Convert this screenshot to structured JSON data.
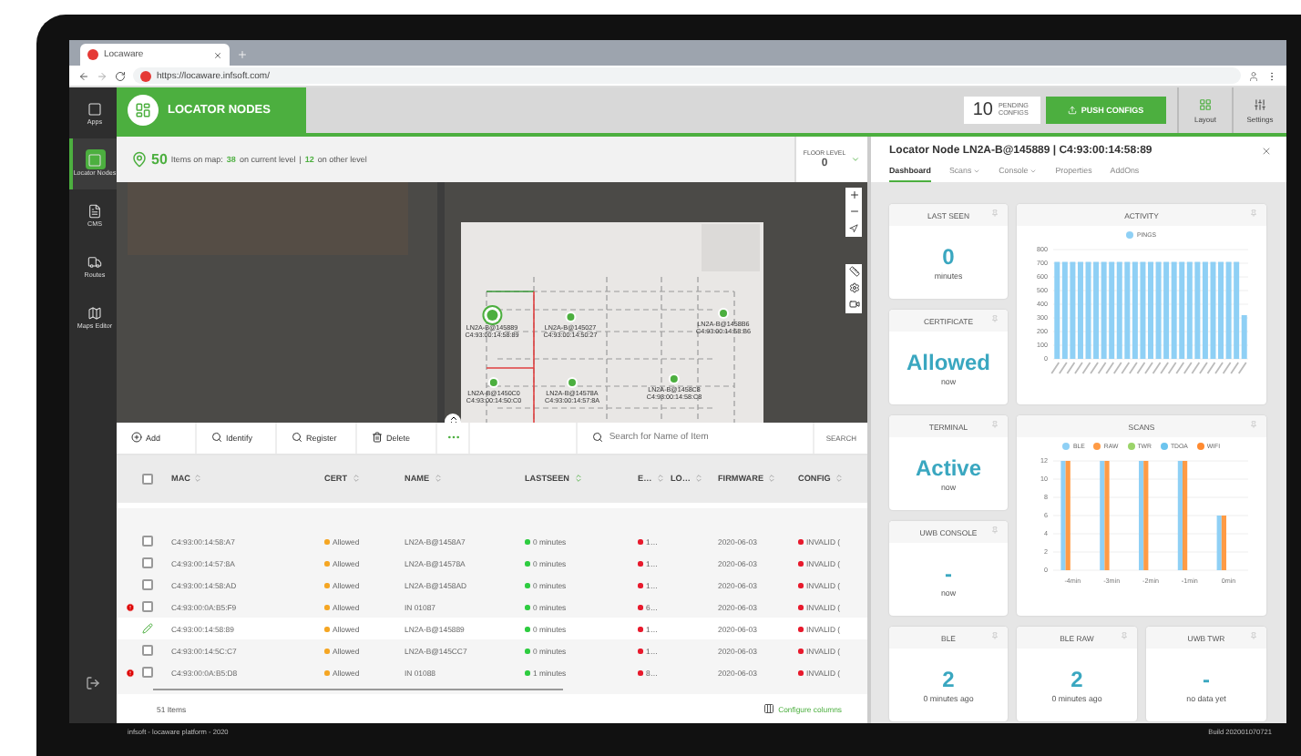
{
  "browser": {
    "tab_title": "Locaware",
    "url": "https://locaware.infsoft.com/"
  },
  "sidebar": {
    "items": [
      {
        "label": "Apps",
        "selected": false
      },
      {
        "label": "Locator Nodes",
        "selected": true
      },
      {
        "label": "CMS",
        "selected": false
      },
      {
        "label": "Routes",
        "selected": false
      },
      {
        "label": "Maps Editor",
        "selected": false
      }
    ]
  },
  "header": {
    "title": "LOCATOR NODES",
    "pending_count": "10",
    "pending_label": "PENDING CONFIGS",
    "push_button": "PUSH CONFIGS",
    "tools": [
      "Layout",
      "Settings"
    ]
  },
  "map_info": {
    "count": "50",
    "text": "Items on map:",
    "current_count": "38",
    "current_label": "on current level",
    "separator": "|",
    "other_count": "12",
    "other_label": "on other level",
    "floor_label": "FLOOR LEVEL",
    "floor_value": "0"
  },
  "map": {
    "nodes": [
      {
        "name": "LN2A-B@145889",
        "mac": "C4:93:00:14:58:89",
        "selected": true
      },
      {
        "name": "LN2A-B@145027",
        "mac": "C4:93:00:14:50:27",
        "selected": false
      },
      {
        "name": "LN2A-B@1458B6",
        "mac": "C4:93:00:14:58:B6",
        "selected": false
      },
      {
        "name": "LN2A-B@1450C0",
        "mac": "C4:93:00:14:50:C0",
        "selected": false
      },
      {
        "name": "LN2A-B@14578A",
        "mac": "C4:93:00:14:57:8A",
        "selected": false
      },
      {
        "name": "LN2A-B@1458C8",
        "mac": "C4:93:00:14:58:C8",
        "selected": false
      }
    ]
  },
  "toolbar": {
    "actions": [
      "Add",
      "Identify",
      "Register",
      "Delete"
    ],
    "search": {
      "placeholder": "Search for Name of Item"
    },
    "search_button": "SEARCH"
  },
  "table": {
    "select_all_checked": false,
    "columns": [
      {
        "label": "MAC",
        "sorted": false
      },
      {
        "label": "CERT",
        "sorted": false
      },
      {
        "label": "NAME",
        "sorted": false
      },
      {
        "label": "LASTSEEN",
        "sorted": true
      },
      {
        "label": "E…",
        "sorted": false
      },
      {
        "label": "LO…",
        "sorted": false
      },
      {
        "label": "FIRMWARE",
        "sorted": false
      },
      {
        "label": "CONFIG",
        "sorted": false
      }
    ],
    "rows": [
      {
        "alert": false,
        "selected": false,
        "mac": "C4:93:00:14:58:A7",
        "cert": "Allowed",
        "name": "LN2A-B@1458A7",
        "lastseen": "0 minutes",
        "e": "1…",
        "firmware": "2020-06-03",
        "config": "INVALID ("
      },
      {
        "alert": false,
        "selected": false,
        "mac": "C4:93:00:14:57:8A",
        "cert": "Allowed",
        "name": "LN2A-B@14578A",
        "lastseen": "0 minutes",
        "e": "1…",
        "firmware": "2020-06-03",
        "config": "INVALID ("
      },
      {
        "alert": false,
        "selected": false,
        "mac": "C4:93:00:14:58:AD",
        "cert": "Allowed",
        "name": "LN2A-B@1458AD",
        "lastseen": "0 minutes",
        "e": "1…",
        "firmware": "2020-06-03",
        "config": "INVALID ("
      },
      {
        "alert": true,
        "selected": false,
        "mac": "C4:93:00:0A:B5:F9",
        "cert": "Allowed",
        "name": "IN 01087",
        "lastseen": "0 minutes",
        "e": "6…",
        "firmware": "2020-06-03",
        "config": "INVALID ("
      },
      {
        "alert": false,
        "selected": true,
        "mac": "C4:93:00:14:58:89",
        "cert": "Allowed",
        "name": "LN2A-B@145889",
        "lastseen": "0 minutes",
        "e": "1…",
        "firmware": "2020-06-03",
        "config": "INVALID ("
      },
      {
        "alert": false,
        "selected": false,
        "mac": "C4:93:00:14:5C:C7",
        "cert": "Allowed",
        "name": "LN2A-B@145CC7",
        "lastseen": "0 minutes",
        "e": "1…",
        "firmware": "2020-06-03",
        "config": "INVALID ("
      },
      {
        "alert": true,
        "selected": false,
        "mac": "C4:93:00:0A:B5:D8",
        "cert": "Allowed",
        "name": "IN 01088",
        "lastseen": "1 minutes",
        "e": "8…",
        "firmware": "2020-06-03",
        "config": "INVALID ("
      }
    ],
    "count": "51 Items",
    "configure": "Configure columns"
  },
  "panel": {
    "title": "Locator Node LN2A-B@145889 | C4:93:00:14:58:89",
    "tabs": [
      {
        "label": "Dashboard",
        "selected": true,
        "dropdown": false
      },
      {
        "label": "Scans",
        "selected": false,
        "dropdown": true
      },
      {
        "label": "Console",
        "selected": false,
        "dropdown": true
      },
      {
        "label": "Properties",
        "selected": false,
        "dropdown": false
      },
      {
        "label": "AddOns",
        "selected": false,
        "dropdown": false
      }
    ],
    "cards": [
      {
        "kind": "stat",
        "title": "LAST SEEN",
        "value": "0",
        "caption": "minutes"
      },
      {
        "kind": "chart",
        "title": "ACTIVITY",
        "chart_data": {
          "type": "bar",
          "series": [
            {
              "name": "PINGS",
              "color": "#8fd0f5",
              "values": [
                710,
                710,
                710,
                710,
                710,
                710,
                710,
                710,
                710,
                710,
                710,
                710,
                710,
                710,
                710,
                710,
                710,
                710,
                710,
                710,
                710,
                710,
                710,
                710,
                320
              ]
            }
          ],
          "ylim": [
            0,
            800
          ],
          "yticks": [
            0,
            100,
            200,
            300,
            400,
            500,
            600,
            700,
            800
          ],
          "grid": true,
          "legend": true
        }
      },
      {
        "kind": "stat",
        "title": "CERTIFICATE",
        "value": "Allowed",
        "caption": "now"
      },
      {
        "kind": "stat",
        "title": "TERMINAL",
        "value": "Active",
        "caption": "now"
      },
      {
        "kind": "chart",
        "title": "SCANS",
        "chart_data": {
          "type": "bar",
          "categories": [
            "-4min",
            "-3min",
            "-2min",
            "-1min",
            "0min"
          ],
          "series": [
            {
              "name": "BLE",
              "color": "#8fd0f5",
              "values": [
                12,
                12,
                12,
                12,
                6
              ]
            },
            {
              "name": "RAW",
              "color": "#ff9b45",
              "values": [
                12,
                12,
                12,
                12,
                6
              ]
            },
            {
              "name": "TWR",
              "color": "#9bd46a",
              "values": [
                0,
                0,
                0,
                0,
                0
              ]
            },
            {
              "name": "TDOA",
              "color": "#6cc4ee",
              "values": [
                0,
                0,
                0,
                0,
                0
              ]
            },
            {
              "name": "WIFI",
              "color": "#ff8a30",
              "values": [
                0,
                0,
                0,
                0,
                0
              ]
            }
          ],
          "ylim": [
            0,
            12
          ],
          "yticks": [
            0,
            2,
            4,
            6,
            8,
            10,
            12
          ],
          "grid": true,
          "legend": true
        }
      },
      {
        "kind": "stat",
        "title": "UWB CONSOLE",
        "value": "-",
        "caption": "now"
      },
      {
        "kind": "stat",
        "title": "BLE",
        "value": "2",
        "caption": "0 minutes ago"
      },
      {
        "kind": "stat",
        "title": "BLE RAW",
        "value": "2",
        "caption": "0 minutes ago"
      },
      {
        "kind": "stat",
        "title": "UWB TWR",
        "value": "-",
        "caption": "no data yet"
      }
    ]
  },
  "footer": {
    "left": "infsoft - locaware platform - 2020",
    "right": "Build 202001070721"
  }
}
